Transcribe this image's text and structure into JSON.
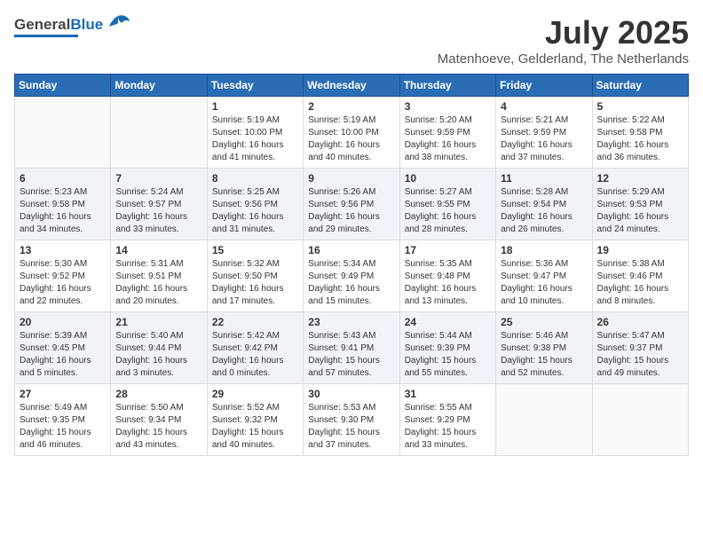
{
  "header": {
    "logo_general": "General",
    "logo_blue": "Blue",
    "month_year": "July 2025",
    "location": "Matenhoeve, Gelderland, The Netherlands"
  },
  "weekdays": [
    "Sunday",
    "Monday",
    "Tuesday",
    "Wednesday",
    "Thursday",
    "Friday",
    "Saturday"
  ],
  "weeks": [
    [
      {
        "day": "",
        "detail": ""
      },
      {
        "day": "",
        "detail": ""
      },
      {
        "day": "1",
        "detail": "Sunrise: 5:19 AM\nSunset: 10:00 PM\nDaylight: 16 hours\nand 41 minutes."
      },
      {
        "day": "2",
        "detail": "Sunrise: 5:19 AM\nSunset: 10:00 PM\nDaylight: 16 hours\nand 40 minutes."
      },
      {
        "day": "3",
        "detail": "Sunrise: 5:20 AM\nSunset: 9:59 PM\nDaylight: 16 hours\nand 38 minutes."
      },
      {
        "day": "4",
        "detail": "Sunrise: 5:21 AM\nSunset: 9:59 PM\nDaylight: 16 hours\nand 37 minutes."
      },
      {
        "day": "5",
        "detail": "Sunrise: 5:22 AM\nSunset: 9:58 PM\nDaylight: 16 hours\nand 36 minutes."
      }
    ],
    [
      {
        "day": "6",
        "detail": "Sunrise: 5:23 AM\nSunset: 9:58 PM\nDaylight: 16 hours\nand 34 minutes."
      },
      {
        "day": "7",
        "detail": "Sunrise: 5:24 AM\nSunset: 9:57 PM\nDaylight: 16 hours\nand 33 minutes."
      },
      {
        "day": "8",
        "detail": "Sunrise: 5:25 AM\nSunset: 9:56 PM\nDaylight: 16 hours\nand 31 minutes."
      },
      {
        "day": "9",
        "detail": "Sunrise: 5:26 AM\nSunset: 9:56 PM\nDaylight: 16 hours\nand 29 minutes."
      },
      {
        "day": "10",
        "detail": "Sunrise: 5:27 AM\nSunset: 9:55 PM\nDaylight: 16 hours\nand 28 minutes."
      },
      {
        "day": "11",
        "detail": "Sunrise: 5:28 AM\nSunset: 9:54 PM\nDaylight: 16 hours\nand 26 minutes."
      },
      {
        "day": "12",
        "detail": "Sunrise: 5:29 AM\nSunset: 9:53 PM\nDaylight: 16 hours\nand 24 minutes."
      }
    ],
    [
      {
        "day": "13",
        "detail": "Sunrise: 5:30 AM\nSunset: 9:52 PM\nDaylight: 16 hours\nand 22 minutes."
      },
      {
        "day": "14",
        "detail": "Sunrise: 5:31 AM\nSunset: 9:51 PM\nDaylight: 16 hours\nand 20 minutes."
      },
      {
        "day": "15",
        "detail": "Sunrise: 5:32 AM\nSunset: 9:50 PM\nDaylight: 16 hours\nand 17 minutes."
      },
      {
        "day": "16",
        "detail": "Sunrise: 5:34 AM\nSunset: 9:49 PM\nDaylight: 16 hours\nand 15 minutes."
      },
      {
        "day": "17",
        "detail": "Sunrise: 5:35 AM\nSunset: 9:48 PM\nDaylight: 16 hours\nand 13 minutes."
      },
      {
        "day": "18",
        "detail": "Sunrise: 5:36 AM\nSunset: 9:47 PM\nDaylight: 16 hours\nand 10 minutes."
      },
      {
        "day": "19",
        "detail": "Sunrise: 5:38 AM\nSunset: 9:46 PM\nDaylight: 16 hours\nand 8 minutes."
      }
    ],
    [
      {
        "day": "20",
        "detail": "Sunrise: 5:39 AM\nSunset: 9:45 PM\nDaylight: 16 hours\nand 5 minutes."
      },
      {
        "day": "21",
        "detail": "Sunrise: 5:40 AM\nSunset: 9:44 PM\nDaylight: 16 hours\nand 3 minutes."
      },
      {
        "day": "22",
        "detail": "Sunrise: 5:42 AM\nSunset: 9:42 PM\nDaylight: 16 hours\nand 0 minutes."
      },
      {
        "day": "23",
        "detail": "Sunrise: 5:43 AM\nSunset: 9:41 PM\nDaylight: 15 hours\nand 57 minutes."
      },
      {
        "day": "24",
        "detail": "Sunrise: 5:44 AM\nSunset: 9:39 PM\nDaylight: 15 hours\nand 55 minutes."
      },
      {
        "day": "25",
        "detail": "Sunrise: 5:46 AM\nSunset: 9:38 PM\nDaylight: 15 hours\nand 52 minutes."
      },
      {
        "day": "26",
        "detail": "Sunrise: 5:47 AM\nSunset: 9:37 PM\nDaylight: 15 hours\nand 49 minutes."
      }
    ],
    [
      {
        "day": "27",
        "detail": "Sunrise: 5:49 AM\nSunset: 9:35 PM\nDaylight: 15 hours\nand 46 minutes."
      },
      {
        "day": "28",
        "detail": "Sunrise: 5:50 AM\nSunset: 9:34 PM\nDaylight: 15 hours\nand 43 minutes."
      },
      {
        "day": "29",
        "detail": "Sunrise: 5:52 AM\nSunset: 9:32 PM\nDaylight: 15 hours\nand 40 minutes."
      },
      {
        "day": "30",
        "detail": "Sunrise: 5:53 AM\nSunset: 9:30 PM\nDaylight: 15 hours\nand 37 minutes."
      },
      {
        "day": "31",
        "detail": "Sunrise: 5:55 AM\nSunset: 9:29 PM\nDaylight: 15 hours\nand 33 minutes."
      },
      {
        "day": "",
        "detail": ""
      },
      {
        "day": "",
        "detail": ""
      }
    ]
  ]
}
